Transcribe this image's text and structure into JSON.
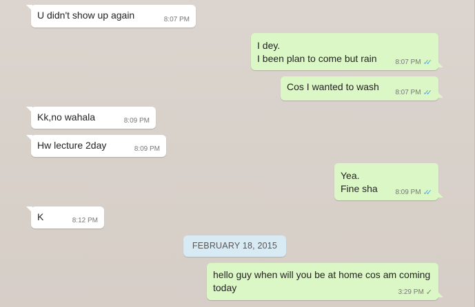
{
  "conversation": {
    "messages": [
      {
        "direction": "in",
        "text": "U didn't show up again",
        "time": "8:07 PM"
      },
      {
        "direction": "out",
        "text": "I dey.\nI been plan to come but rain",
        "time": "8:07 PM",
        "status": "read-double-tick-icon"
      },
      {
        "direction": "out",
        "text": "Cos I wanted to wash",
        "time": "8:07 PM",
        "status": "read-double-tick-icon"
      },
      {
        "direction": "in",
        "text": "Kk,no wahala",
        "time": "8:09 PM"
      },
      {
        "direction": "in",
        "text": "Hw lecture 2day",
        "time": "8:09 PM"
      },
      {
        "direction": "out",
        "text": "Yea.\nFine sha",
        "time": "8:09 PM",
        "status": "read-double-tick-icon"
      },
      {
        "direction": "in",
        "text": "K",
        "time": "8:12 PM"
      },
      {
        "direction": "out",
        "text": "hello guy when will you be at home cos am coming\ntoday",
        "time": "3:29 PM",
        "status": "sent-single-tick-icon"
      }
    ],
    "date_separator": "FEBRUARY 18, 2015",
    "colors": {
      "incoming_bubble": "#ffffff",
      "outgoing_bubble": "#dcf7c6",
      "read_tick": "#4fa8d8",
      "date_pill": "#d8ebf4",
      "wallpaper": "#d9d2cc"
    }
  }
}
